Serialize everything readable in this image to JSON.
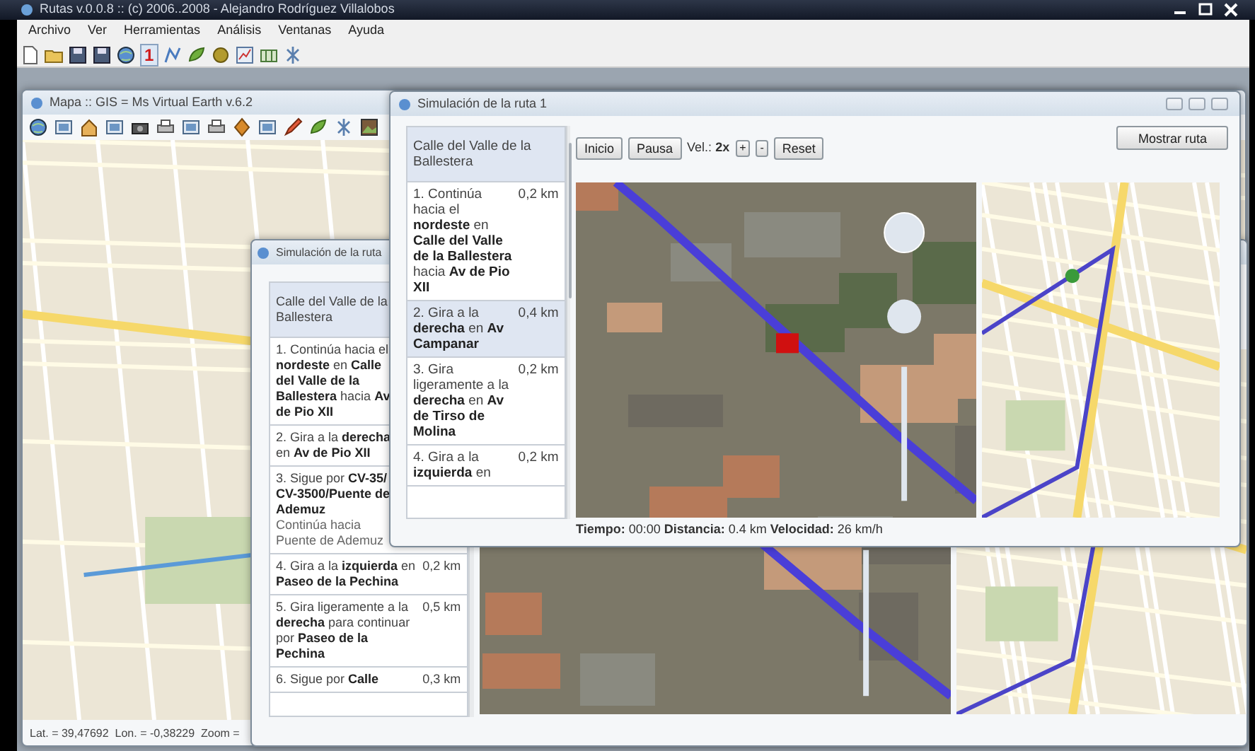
{
  "app": {
    "title": "Rutas v.0.0.8 :: (c) 2006..2008 - Alejandro Rodríguez Villalobos"
  },
  "menu": [
    "Archivo",
    "Ver",
    "Herramientas",
    "Análisis",
    "Ventanas",
    "Ayuda"
  ],
  "toolbar": {
    "route_number": "1"
  },
  "map_window": {
    "title": "Mapa :: GIS = Ms Virtual Earth v.6.2",
    "status": "Lat. = 39,47692  Lon. = -0,38229  Zoom ="
  },
  "route_window_back": {
    "title": "Simulación de la ruta",
    "steps": [
      {
        "kind": "header",
        "text": "Calle del Valle de la Ballestera",
        "selected": true
      },
      {
        "kind": "step",
        "text": "1. Continúa hacia el **nordeste** en **Calle del Valle de la Ballestera** hacia **Av de Pio XII**",
        "selected": false
      },
      {
        "kind": "step",
        "text": "2. Gira a la **derecha** en **Av de Pio XII**",
        "selected": false
      },
      {
        "kind": "step",
        "text": "3. Sigue por **CV-35/ CV-3500/Puente de Ademuz**",
        "note": "Continúa hacia Puente de Ademuz",
        "selected": false
      },
      {
        "kind": "step",
        "text": "4. Gira a la **izquierda** en **Paseo de la Pechina**",
        "distance": "0,2 km",
        "selected": false
      },
      {
        "kind": "step",
        "text": "5. Gira ligeramente a la **derecha** para continuar por **Paseo de la Pechina**",
        "distance": "0,5 km",
        "selected": false
      },
      {
        "kind": "step",
        "text": "6. Sigue por **Calle**",
        "distance": "0,3 km",
        "selected": false
      }
    ]
  },
  "route_window": {
    "title": "Simulación de la ruta 1",
    "show_route": "Mostrar ruta",
    "controls": [
      {
        "kind": "button",
        "label": "Inicio"
      },
      {
        "kind": "button",
        "label": "Pausa"
      },
      {
        "kind": "label",
        "text": "Vel.: **2x**"
      },
      {
        "kind": "small-button",
        "label": "+"
      },
      {
        "kind": "small-button",
        "label": "-"
      },
      {
        "kind": "button",
        "label": "Reset"
      }
    ],
    "steps": [
      {
        "kind": "header",
        "text": "Calle del Valle de la Ballestera",
        "selected": true
      },
      {
        "kind": "step",
        "text": "1. Continúa hacia el **nordeste** en **Calle del Valle de la Ballestera** hacia **Av de Pio XII**",
        "distance": "0,2 km",
        "selected": false
      },
      {
        "kind": "step",
        "text": "2. Gira a la **derecha** en **Av Campanar**",
        "distance": "0,4 km",
        "selected": true
      },
      {
        "kind": "step",
        "text": "3. Gira ligeramente a la **derecha** en **Av de Tirso de Molina**",
        "distance": "0,2 km",
        "selected": false
      },
      {
        "kind": "step",
        "text": "4. Gira a la **izquierda** en",
        "distance": "0,2 km",
        "selected": false
      }
    ],
    "status": "**Tiempo:** 00:00 **Distancia:** 0.4 km **Velocidad:** 26 km/h"
  }
}
